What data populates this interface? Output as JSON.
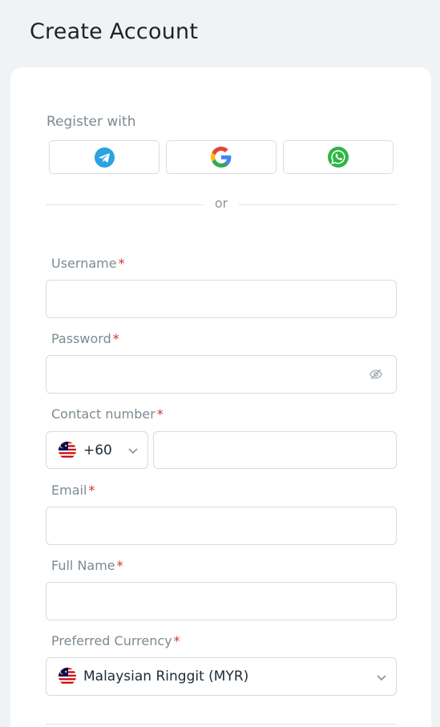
{
  "page": {
    "title": "Create Account"
  },
  "register": {
    "label": "Register with",
    "providers": [
      {
        "name": "telegram-icon",
        "color": "#2aa3e0"
      },
      {
        "name": "google-icon",
        "color": "#4285f4"
      },
      {
        "name": "whatsapp-icon",
        "color": "#2cb742"
      }
    ],
    "divider_text": "or"
  },
  "fields": {
    "username": {
      "label": "Username",
      "required_mark": "*",
      "value": ""
    },
    "password": {
      "label": "Password",
      "required_mark": "*",
      "value": ""
    },
    "contact": {
      "label": "Contact number",
      "required_mark": "*",
      "country_code": "+60",
      "value": ""
    },
    "email": {
      "label": "Email",
      "required_mark": "*",
      "value": ""
    },
    "full_name": {
      "label": "Full Name",
      "required_mark": "*",
      "value": ""
    },
    "currency": {
      "label": "Preferred Currency",
      "required_mark": "*",
      "selected": "Malaysian Ringgit (MYR)"
    }
  },
  "colors": {
    "required": "#d32f2f",
    "label": "#7d8a92",
    "border": "#d6dbdf"
  }
}
